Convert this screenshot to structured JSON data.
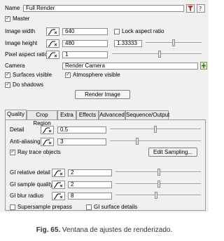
{
  "name": {
    "label": "Name",
    "value": "Full Render"
  },
  "master": {
    "label": "Master",
    "checked": true
  },
  "image_width": {
    "label": "Image width",
    "value": "640"
  },
  "lock_aspect": {
    "label": "Lock aspect ratio",
    "checked": false
  },
  "image_height": {
    "label": "Image height",
    "value": "480",
    "ratio": "1.33333"
  },
  "pixel_aspect": {
    "label": "Pixel aspect ratio",
    "value": "1"
  },
  "camera": {
    "label": "Camera",
    "value": "Render Camera"
  },
  "surfaces_visible": {
    "label": "Surfaces visible",
    "checked": true
  },
  "atmosphere_visible": {
    "label": "Atmosphere visible",
    "checked": true
  },
  "do_shadows": {
    "label": "Do shadows",
    "checked": true
  },
  "render_button": "Render Image",
  "tabs": [
    "Quality",
    "Crop Region",
    "Extra",
    "Effects",
    "Advanced",
    "Sequence/Output"
  ],
  "active_tab": "Quality",
  "detail": {
    "label": "Detail",
    "value": "0.5",
    "level": 0.5
  },
  "anti_aliasing": {
    "label": "Anti-aliasing",
    "value": "3",
    "level": 0.3
  },
  "ray_trace": {
    "label": "Ray trace objects",
    "checked": true
  },
  "edit_sampling_button": "Edit Sampling...",
  "gi_relative_detail": {
    "label": "GI relative detail",
    "value": "2"
  },
  "gi_sample_quality": {
    "label": "GI sample quality",
    "value": "2"
  },
  "gi_blur_radius": {
    "label": "GI blur radius",
    "value": "8"
  },
  "supersample_prepass": {
    "label": "Supersample prepass",
    "checked": false
  },
  "gi_surface_details": {
    "label": "GI surface details",
    "checked": false
  },
  "caption": {
    "prefix": "Fig. 65.",
    "text": " Ventana de ajustes de renderizado."
  }
}
